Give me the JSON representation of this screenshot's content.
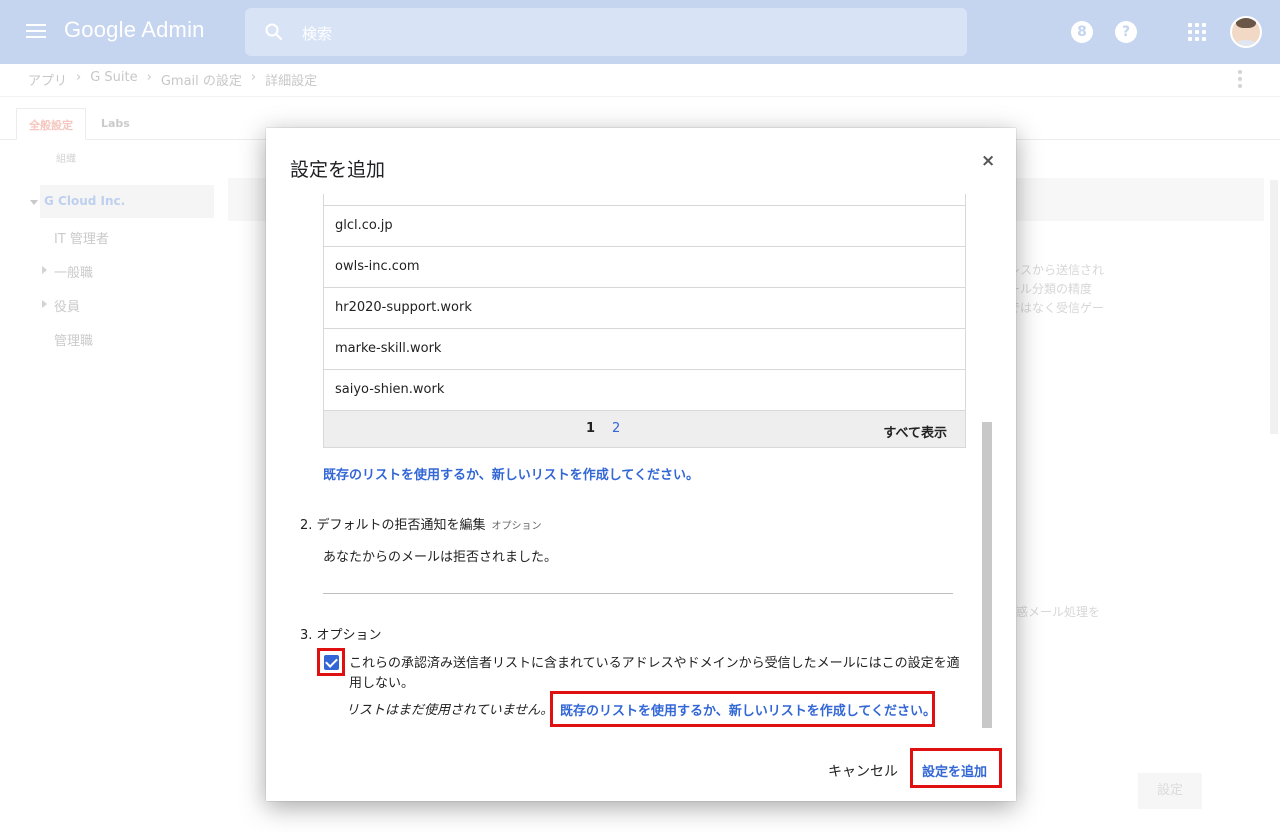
{
  "header": {
    "brand": "Google Admin",
    "search_placeholder": "検索",
    "icons": [
      "menu-icon",
      "search-icon",
      "g-suite-icon",
      "help-icon",
      "apps-icon",
      "avatar"
    ],
    "bar_color": "#c5d4ef"
  },
  "breadcrumb": [
    "アプリ",
    "G Suite",
    "Gmail の設定",
    "詳細設定"
  ],
  "tabs": {
    "general": "全般設定",
    "labs": "Labs"
  },
  "org": {
    "heading": "組織",
    "items": [
      "G Cloud Inc.",
      "IT 管理者",
      "一般職",
      "役員",
      "管理職"
    ]
  },
  "background_text": {
    "snippet_1": [
      "レスから送信され",
      "ール分類の精度",
      "ではなく受信ゲー"
    ],
    "snippet_2": "惑メール処理を",
    "save_button": "設定"
  },
  "dialog": {
    "title": "設定を追加",
    "close": "×",
    "domains": [
      "glcl.co.jp",
      "owls-inc.com",
      "hr2020-support.work",
      "marke-skill.work",
      "saiyo-shien.work"
    ],
    "pager": {
      "current": "1",
      "next": "2",
      "show_all": "すべて表示"
    },
    "list_link": "既存のリストを使用するか、新しいリストを作成してください。",
    "section2": {
      "title": "2. デフォルトの拒否通知を編集",
      "tag": "オプション",
      "value": "あなたからのメールは拒否されました。"
    },
    "section3": {
      "title": "3. オプション",
      "checkbox_checked": true,
      "checkbox_label": "これらの承認済み送信者リストに含まれているアドレスやドメインから受信したメールにはこの設定を適用しない。",
      "unused_text": "リストはまだ使用されていません。",
      "link": "既存のリストを使用するか、新しいリストを作成してください。"
    },
    "cancel": "キャンセル",
    "add": "設定を追加"
  },
  "colors": {
    "link": "#3367d6",
    "highlight": "#e01010"
  }
}
